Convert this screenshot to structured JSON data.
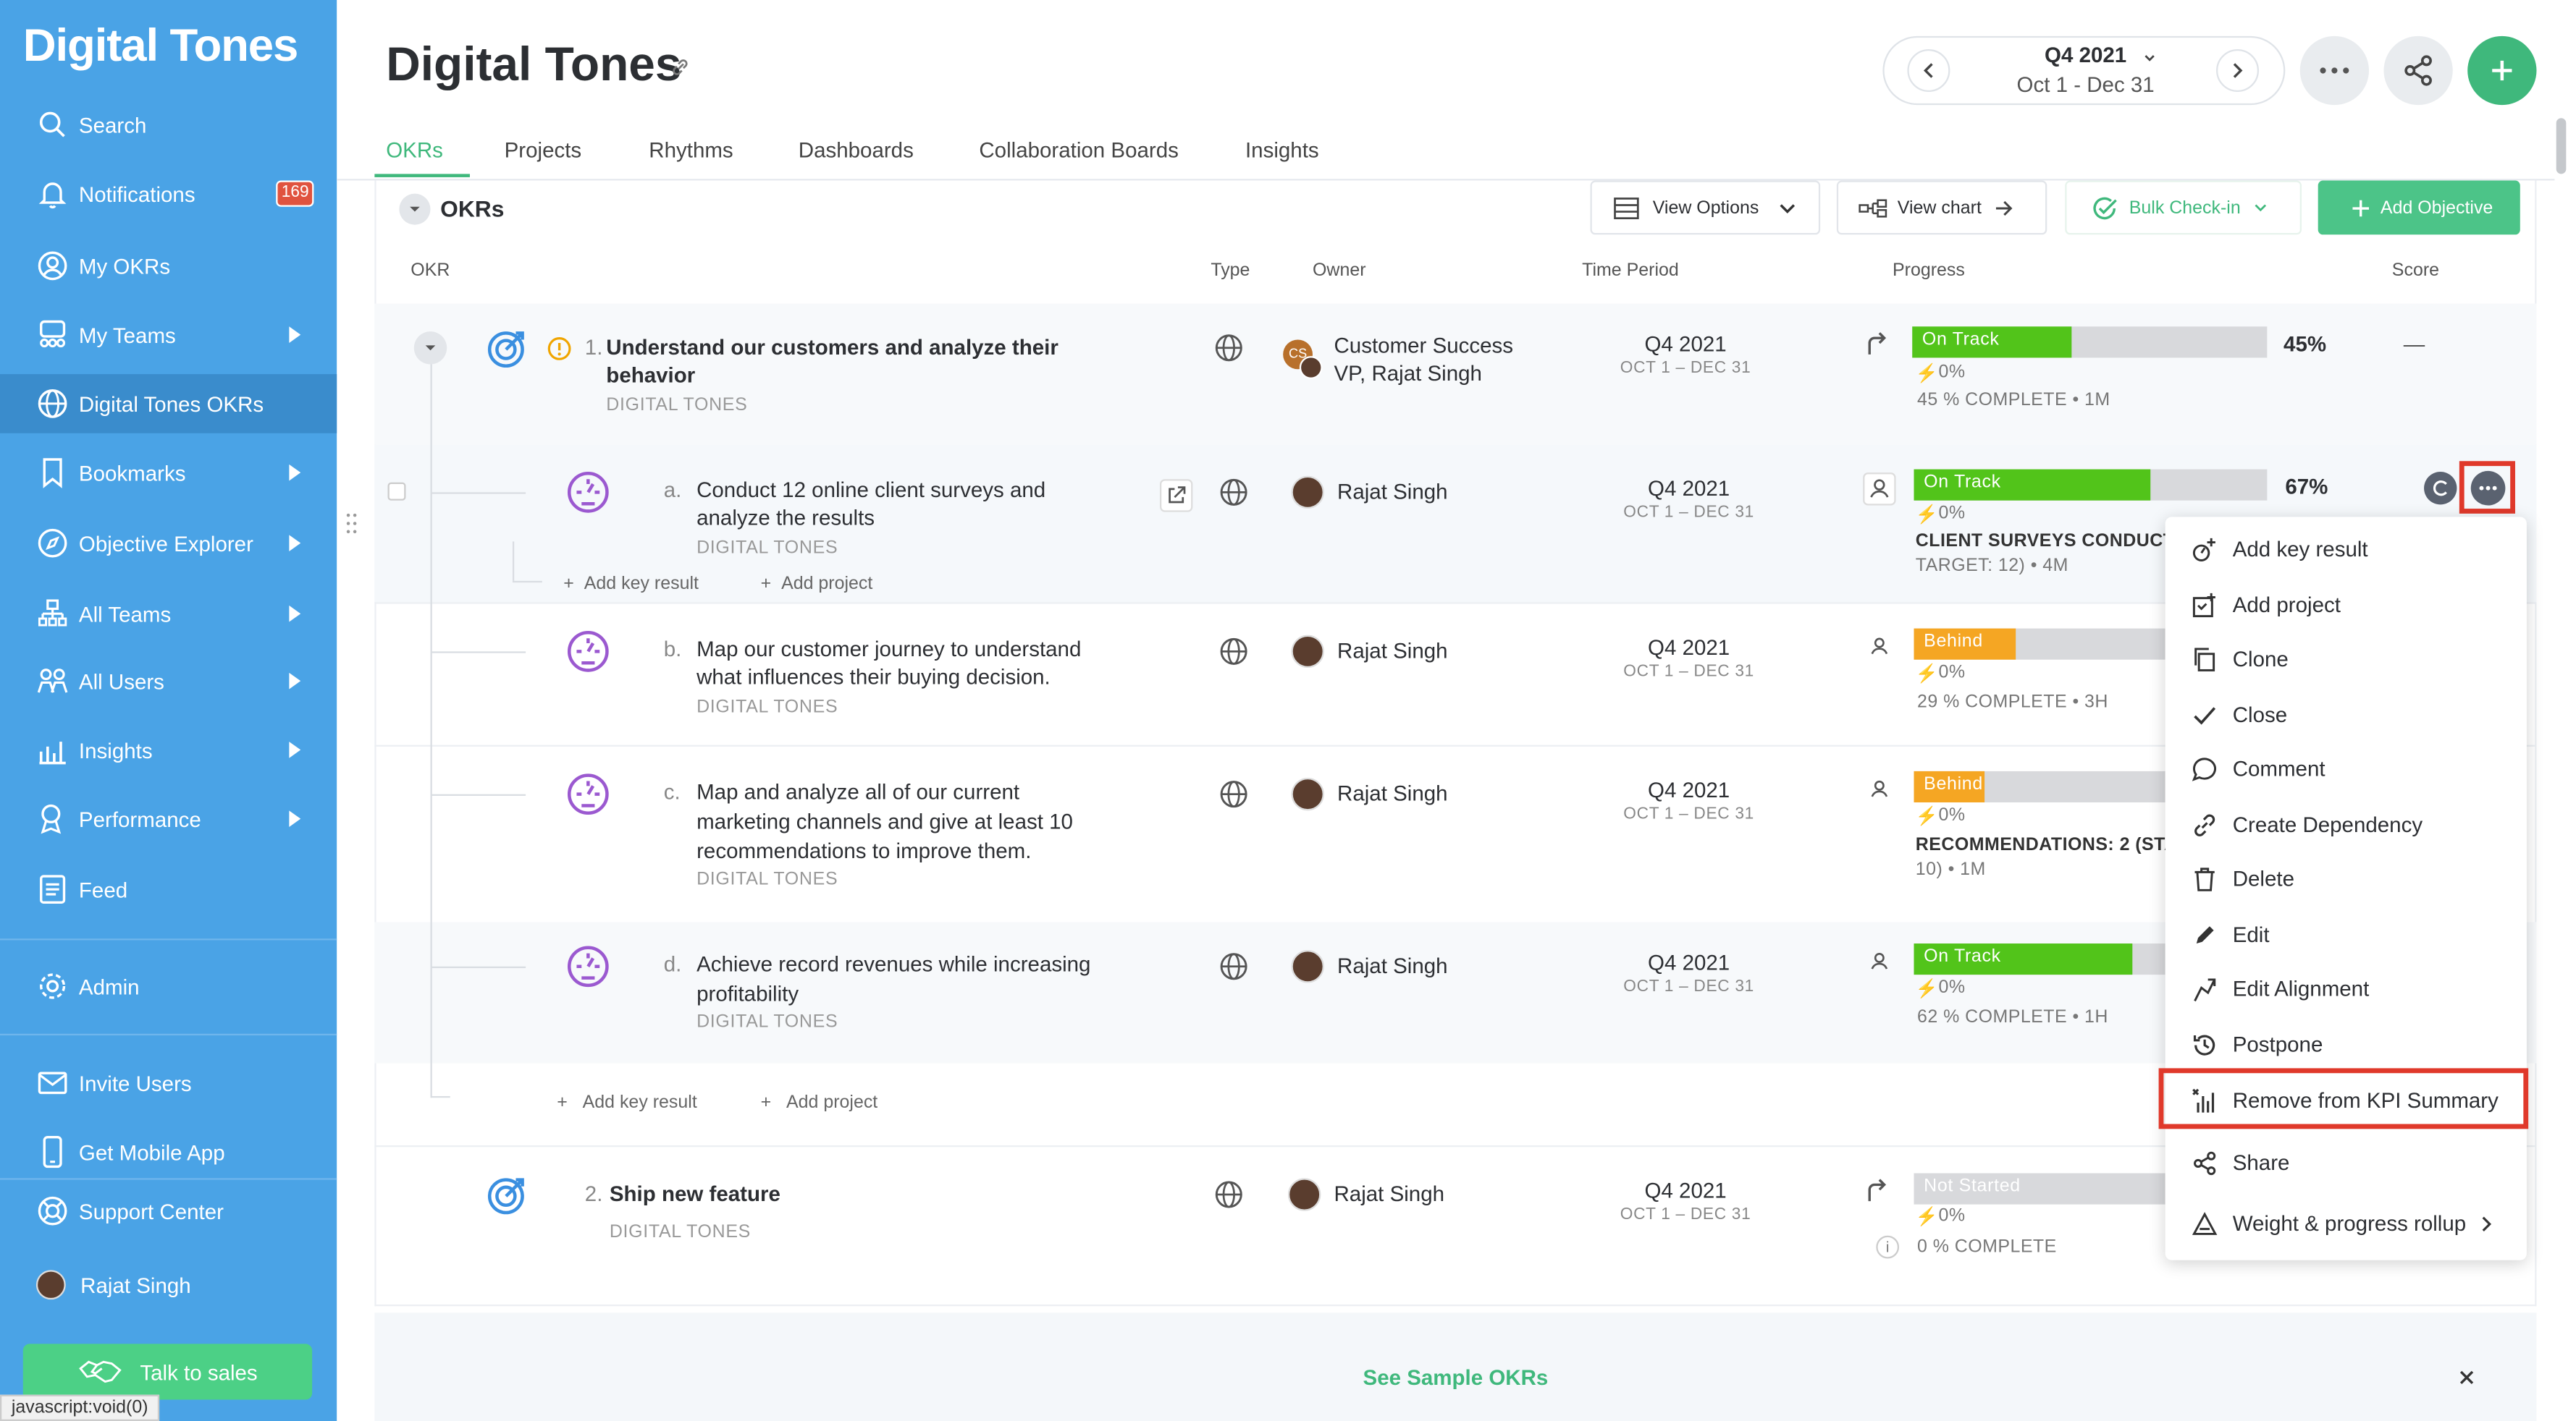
{
  "sidebar": {
    "brand": "Digital Tones",
    "items": [
      {
        "label": "Search",
        "icon": "search-icon"
      },
      {
        "label": "Notifications",
        "icon": "bell-icon",
        "badge": "169"
      },
      {
        "label": "My OKRs",
        "icon": "user-circle-icon"
      },
      {
        "label": "My Teams",
        "icon": "team-icon"
      },
      {
        "label": "Digital Tones OKRs",
        "icon": "globe-icon"
      },
      {
        "label": "Bookmarks",
        "icon": "bookmark-icon"
      },
      {
        "label": "Objective Explorer",
        "icon": "compass-icon"
      },
      {
        "label": "All Teams",
        "icon": "org-chart-icon"
      },
      {
        "label": "All Users",
        "icon": "users-icon"
      },
      {
        "label": "Insights",
        "icon": "bar-chart-icon"
      },
      {
        "label": "Performance",
        "icon": "award-icon"
      },
      {
        "label": "Feed",
        "icon": "feed-icon"
      }
    ],
    "admin": "Admin",
    "invite": "Invite Users",
    "mobile": "Get Mobile App",
    "support": "Support Center",
    "user": "Rajat Singh",
    "talk": "Talk to sales",
    "status": "javascript:void(0)"
  },
  "header": {
    "title": "Digital Tones",
    "period_quarter": "Q4 2021",
    "period_dates": "Oct 1 - Dec 31",
    "tabs": [
      "OKRs",
      "Projects",
      "Rhythms",
      "Dashboards",
      "Collaboration Boards",
      "Insights"
    ]
  },
  "toolbar": {
    "section": "OKRs",
    "view_options": "View Options",
    "view_chart": "View chart",
    "bulk_checkin": "Bulk Check-in",
    "add_objective": "Add Objective"
  },
  "columns": {
    "okr": "OKR",
    "type": "Type",
    "owner": "Owner",
    "time": "Time Period",
    "progress": "Progress",
    "score": "Score"
  },
  "objective1": {
    "num": "1.",
    "title_l1": "Understand our customers and analyze their",
    "title_l2": "behavior",
    "team": "DIGITAL TONES",
    "owner_l1": "Customer Success",
    "owner_l2": "VP, Rajat Singh",
    "avatar_initials": "CS",
    "q": "Q4 2021",
    "d": "OCT 1 – DEC 31",
    "status": "On Track",
    "pct": "45%",
    "progress": 0.45,
    "delta": "0%",
    "complete": "45 % COMPLETE • 1M",
    "score": "—"
  },
  "krs": [
    {
      "letter": "a.",
      "l1": "Conduct 12 online client surveys and",
      "l2": "analyze the results",
      "l3": "",
      "team": "DIGITAL TONES",
      "owner": "Rajat Singh",
      "q": "Q4 2021",
      "d": "OCT 1 – DEC 31",
      "status": "On Track",
      "pct": "67%",
      "progress": 0.67,
      "delta": "0%",
      "info1": "CLIENT SURVEYS CONDUCTI",
      "info2": "TARGET: 12) • 4M"
    },
    {
      "letter": "b.",
      "l1": "Map our customer journey to understand",
      "l2": "what influences their buying decision.",
      "l3": "",
      "team": "DIGITAL TONES",
      "owner": "Rajat Singh",
      "q": "Q4 2021",
      "d": "OCT 1 – DEC 31",
      "status": "Behind",
      "pct": "",
      "progress": 0.29,
      "delta": "0%",
      "info1": "29 % COMPLETE • 3H",
      "info2": ""
    },
    {
      "letter": "c.",
      "l1": "Map and analyze all of our current",
      "l2": "marketing channels and give at least 10",
      "l3": "recommendations to improve them.",
      "team": "DIGITAL TONES",
      "owner": "Rajat Singh",
      "q": "Q4 2021",
      "d": "OCT 1 – DEC 31",
      "status": "Behind",
      "pct": "",
      "progress": 0.2,
      "delta": "0%",
      "info1": "RECOMMENDATIONS: 2 (STA",
      "info2": "10) • 1M"
    },
    {
      "letter": "d.",
      "l1": "Achieve record revenues while increasing",
      "l2": "profitability",
      "l3": "",
      "team": "DIGITAL TONES",
      "owner": "Rajat Singh",
      "q": "Q4 2021",
      "d": "OCT 1 – DEC 31",
      "status": "On Track",
      "pct": "",
      "progress": 0.62,
      "delta": "0%",
      "info1": "62 % COMPLETE • 1H",
      "info2": ""
    }
  ],
  "add_key_result": "Add key result",
  "add_project": "Add project",
  "objective2": {
    "num": "2.",
    "title": "Ship new feature",
    "team": "DIGITAL TONES",
    "owner": "Rajat Singh",
    "q": "Q4 2021",
    "d": "OCT 1 – DEC 31",
    "status": "Not Started",
    "delta": "0%",
    "complete": "0 % COMPLETE"
  },
  "menu": [
    {
      "label": "Add key result",
      "icon": "add-key-result-icon"
    },
    {
      "label": "Add project",
      "icon": "add-project-icon"
    },
    {
      "label": "Clone",
      "icon": "clone-icon"
    },
    {
      "label": "Close",
      "icon": "check-icon"
    },
    {
      "label": "Comment",
      "icon": "comment-icon"
    },
    {
      "label": "Create Dependency",
      "icon": "link-icon"
    },
    {
      "label": "Delete",
      "icon": "trash-icon"
    },
    {
      "label": "Edit",
      "icon": "pencil-icon"
    },
    {
      "label": "Edit Alignment",
      "icon": "alignment-icon"
    },
    {
      "label": "Postpone",
      "icon": "history-icon"
    },
    {
      "label": "Remove from KPI Summary",
      "icon": "kpi-chart-icon"
    },
    {
      "label": "Share",
      "icon": "share-icon"
    },
    {
      "label": "Weight & progress rollup",
      "icon": "scale-icon"
    }
  ],
  "sample": "See Sample OKRs",
  "colors": {
    "sidebar": "#4aa3e6",
    "green": "#3fb87c",
    "on_track": "#52c41a",
    "behind": "#f5a623",
    "highlight": "#e0392b"
  }
}
